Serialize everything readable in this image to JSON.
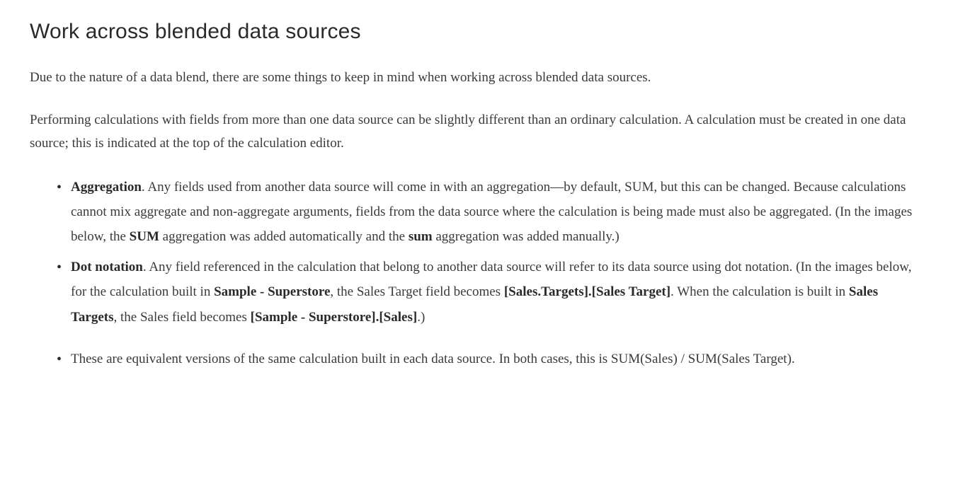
{
  "heading": "Work across blended data sources",
  "para1": "Due to the nature of a data blend, there are some things to keep in mind when working across blended data sources.",
  "para2": "Performing calculations with fields from more than one data source can be slightly different than an ordinary calculation. A calculation must be created in one data source; this is indicated at the top of the calculation editor.",
  "bullet1": {
    "term": "Aggregation",
    "text_a": ". Any fields used from another data source will come in with an aggregation—by default, SUM, but this can be changed. Because calculations cannot mix aggregate and non-aggregate arguments, fields from the data source where the calculation is being made must also be aggregated. (In the images below, the ",
    "bold_b": "SUM",
    "text_c": " aggregation was added automatically and the ",
    "bold_d": "sum",
    "text_e": " aggregation was added manually.)"
  },
  "bullet2": {
    "term": "Dot notation",
    "text_a": ". Any field referenced in the calculation that belong to another data source will refer to its data source using dot notation. (In the images below, for the calculation built in ",
    "bold_b": "Sample - Superstore",
    "text_c": ", the Sales Target field becomes ",
    "bold_d": "[Sales.Targets].[Sales Target]",
    "text_e": ". When the calculation is built in ",
    "bold_f": "Sales Targets",
    "text_g": ", the Sales field becomes ",
    "bold_h": "[Sample - Superstore].[Sales]",
    "text_i": ".)"
  },
  "bullet3": "These are equivalent versions of the same calculation built in each data source. In both cases, this is SUM(Sales) / SUM(Sales Target)."
}
